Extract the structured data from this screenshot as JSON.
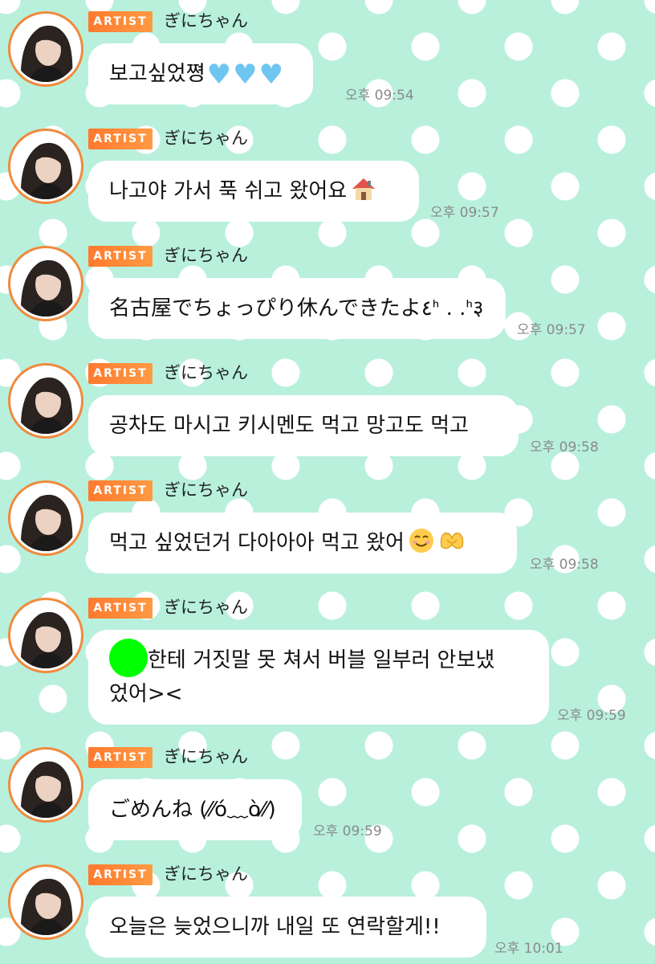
{
  "badge_label": "ARTIST",
  "artist_name": "ぎにちゃん",
  "messages": [
    {
      "text": "보고싶었쪙",
      "time": "오후 09:54"
    },
    {
      "text": "나고야 가서 푹 쉬고 왔어요",
      "time": "오후 09:57"
    },
    {
      "text": "名古屋でちょっぴり休んできたよ٤ᑋ . .ᑋ३",
      "time": "오후 09:57"
    },
    {
      "text": "공차도 마시고 키시멘도 먹고 망고도 먹고",
      "time": "오후 09:58"
    },
    {
      "text": "먹고 싶었던거 다아아아 먹고 왔어",
      "time": "오후 09:58"
    },
    {
      "text_line1": "한테 거짓말 못 쳐서 버블 일부러 안보냈",
      "text_line2": "었어><",
      "time": "오후 09:59"
    },
    {
      "text": "ごめんね (⁄⁄ó﹏ò⁄⁄)",
      "time": "오후 09:59"
    },
    {
      "text": "오늘은 늦었으니까 내일 또 연락할게!!",
      "time": "오후 10:01"
    }
  ],
  "icons": {
    "heart": "blue-heart-icon",
    "house": "house-icon",
    "smile": "smiling-face-icon",
    "hands": "heart-hands-icon"
  },
  "colors": {
    "background": "#b8f0dc",
    "bubble": "#ffffff",
    "badge": "#ff8a3a",
    "avatar_ring": "#f08a3c",
    "time": "#8a8a8a",
    "redaction": "#00ff00"
  }
}
